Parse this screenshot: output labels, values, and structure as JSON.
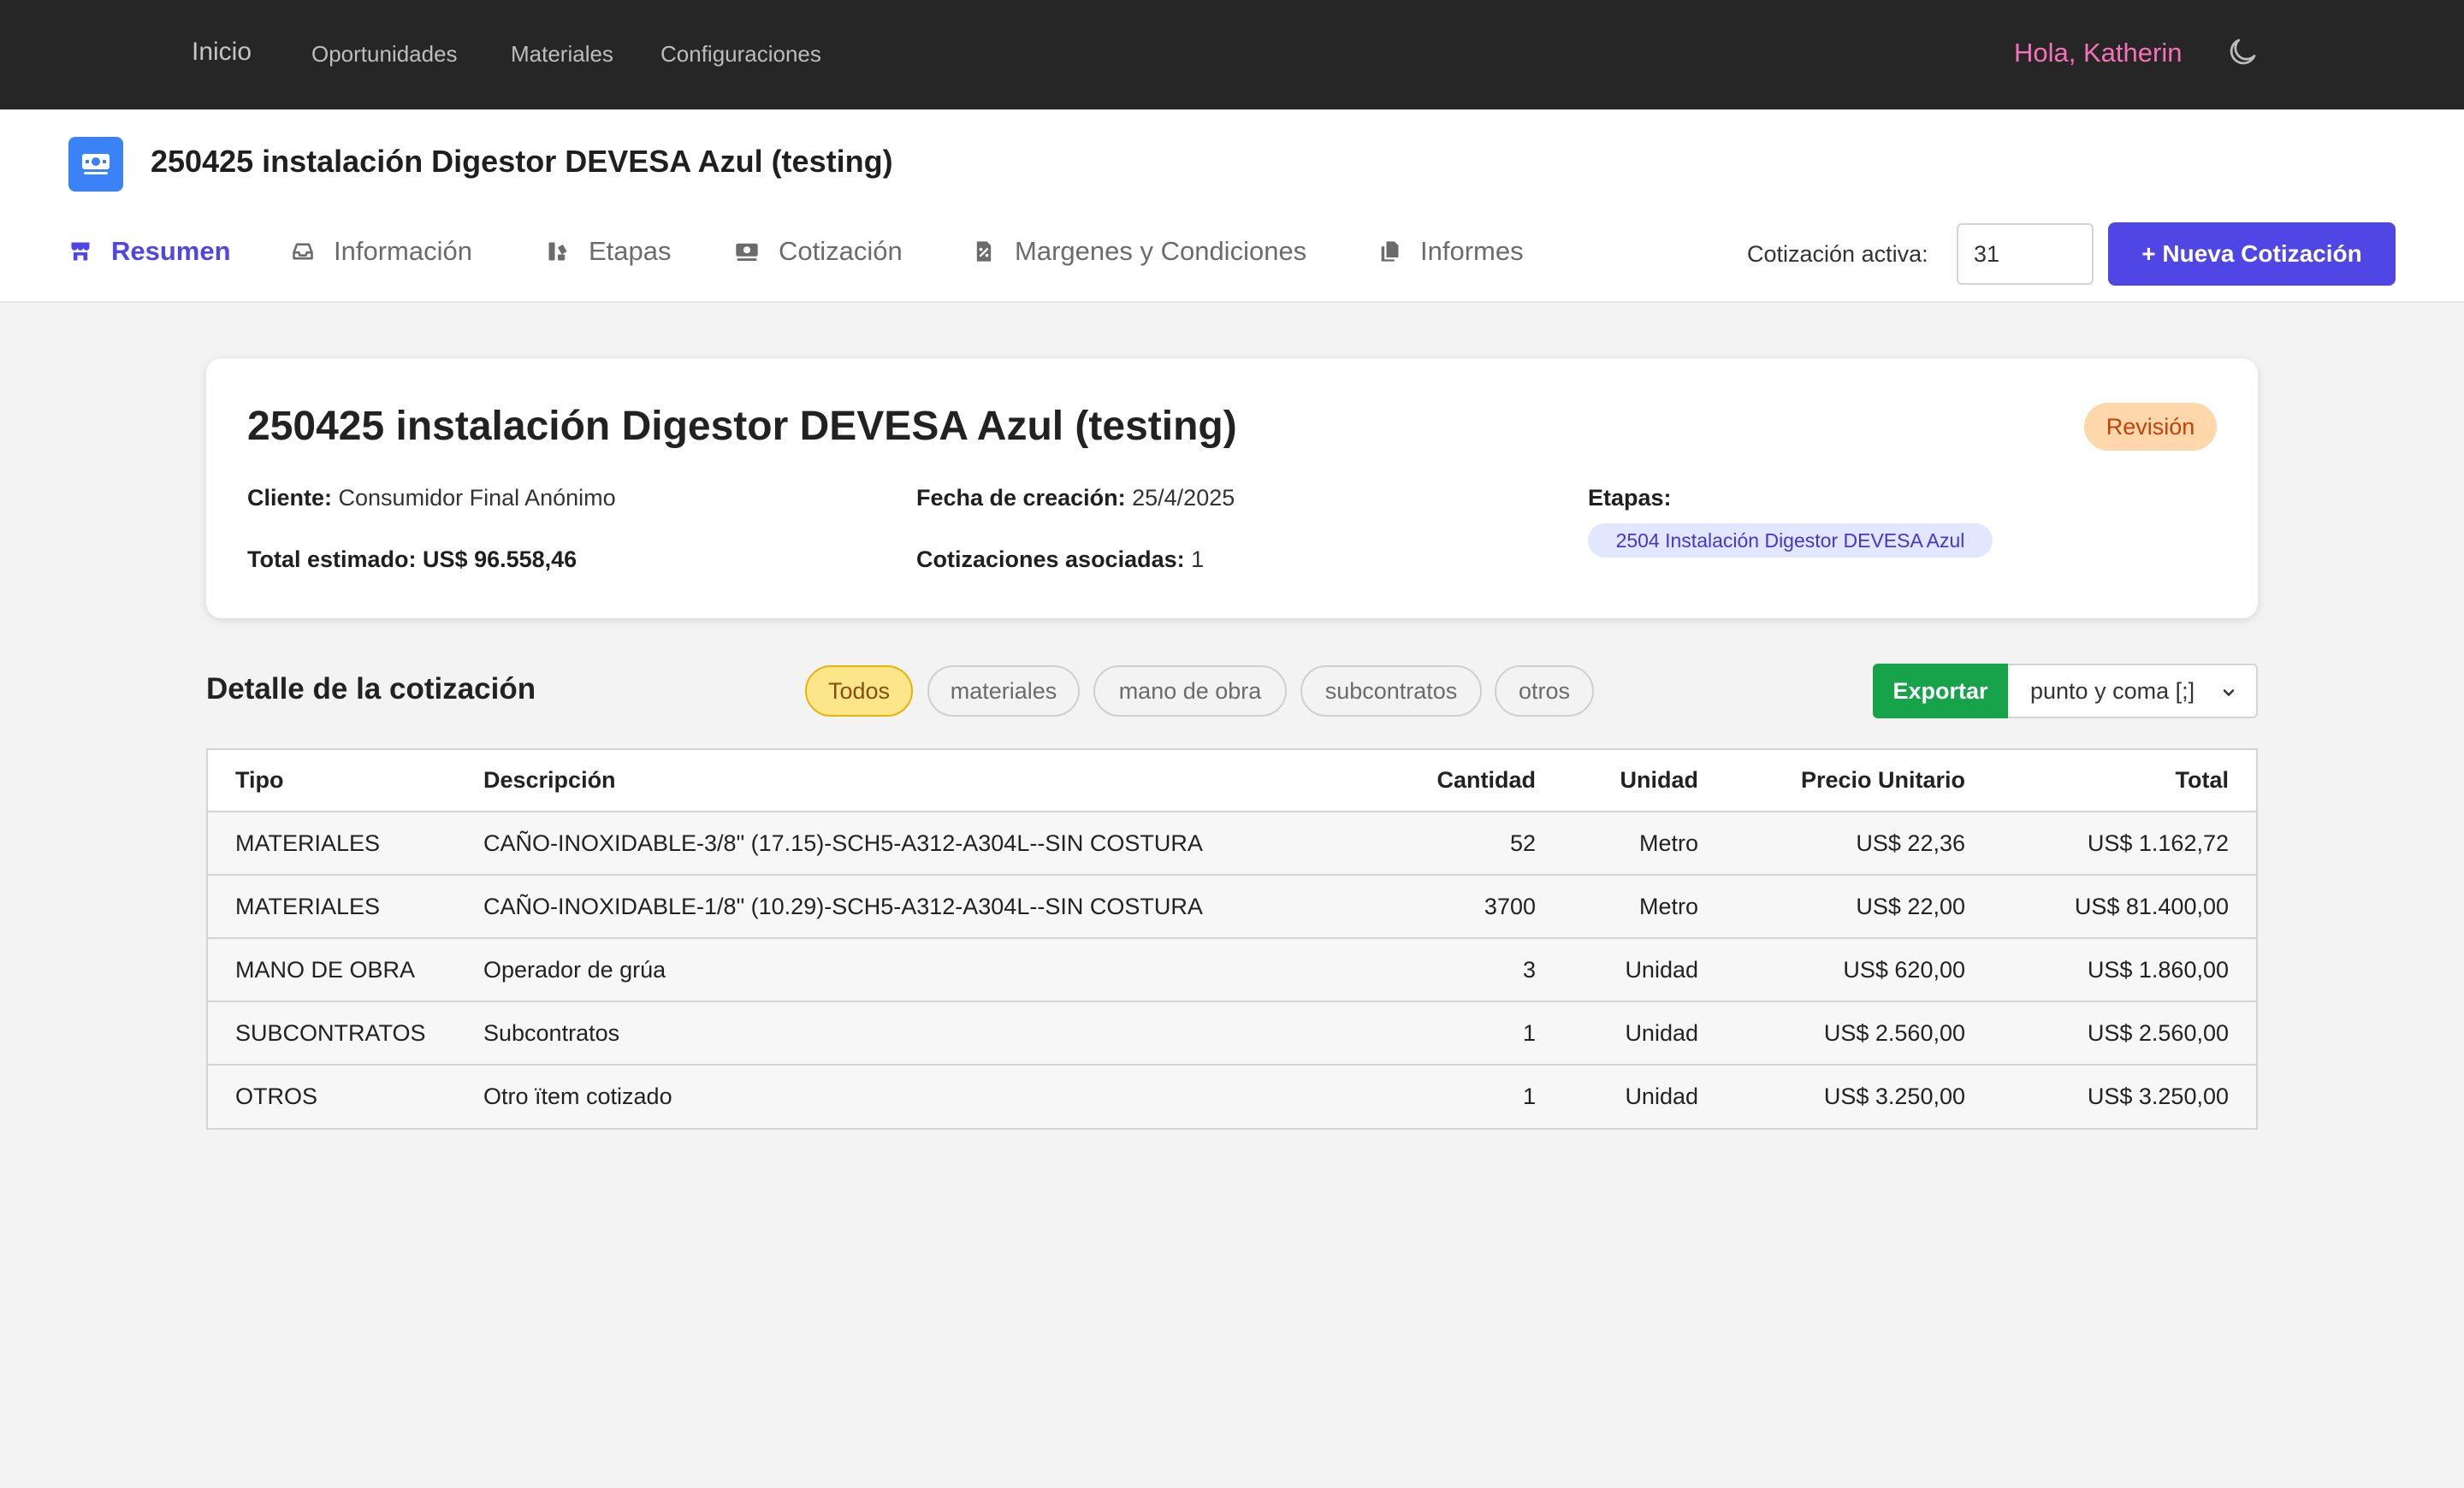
{
  "nav": {
    "home": "Inicio",
    "links": [
      "Oportunidades",
      "Materiales",
      "Configuraciones"
    ],
    "greeting": "Hola, Katherin",
    "theme_icon": "moon-icon"
  },
  "header": {
    "icon": "money-icon",
    "title": "250425 instalación Digestor DEVESA Azul (testing)",
    "tabs": [
      {
        "label": "Resumen",
        "icon": "store-icon",
        "active": true
      },
      {
        "label": "Información",
        "icon": "inbox-icon"
      },
      {
        "label": "Etapas",
        "icon": "stages-icon"
      },
      {
        "label": "Cotización",
        "icon": "money-icon"
      },
      {
        "label": "Margenes y Condiciones",
        "icon": "file-icon"
      },
      {
        "label": "Informes",
        "icon": "copy-icon"
      }
    ],
    "active_quote_label": "Cotización activa:",
    "active_quote_value": "31",
    "new_quote_label": "+ Nueva Cotización"
  },
  "summary": {
    "title": "250425 instalación Digestor DEVESA Azul (testing)",
    "status": "Revisión",
    "client_label": "Cliente:",
    "client_value": "Consumidor Final Anónimo",
    "created_label": "Fecha de creación:",
    "created_value": "25/4/2025",
    "stages_label": "Etapas:",
    "stage_pill": "2504 Instalación Digestor DEVESA Azul",
    "total_label": "Total estimado:",
    "total_value": "US$ 96.558,46",
    "quotes_label": "Cotizaciones asociadas:",
    "quotes_value": "1"
  },
  "detail": {
    "title": "Detalle de la cotización",
    "filters": [
      "Todos",
      "materiales",
      "mano de obra",
      "subcontratos",
      "otros"
    ],
    "active_filter": "Todos",
    "export_label": "Exportar",
    "separator_value": "punto y coma [;]"
  },
  "table": {
    "headers": [
      "Tipo",
      "Descripción",
      "Cantidad",
      "Unidad",
      "Precio Unitario",
      "Total"
    ],
    "rows": [
      [
        "MATERIALES",
        "CAÑO-INOXIDABLE-3/8\" (17.15)-SCH5-A312-A304L--SIN COSTURA",
        "52",
        "Metro",
        "US$ 22,36",
        "US$ 1.162,72"
      ],
      [
        "MATERIALES",
        "CAÑO-INOXIDABLE-1/8\" (10.29)-SCH5-A312-A304L--SIN COSTURA",
        "3700",
        "Metro",
        "US$ 22,00",
        "US$ 81.400,00"
      ],
      [
        "MANO DE OBRA",
        "Operador de grúa",
        "3",
        "Unidad",
        "US$ 620,00",
        "US$ 1.860,00"
      ],
      [
        "SUBCONTRATOS",
        "Subcontratos",
        "1",
        "Unidad",
        "US$ 2.560,00",
        "US$ 2.560,00"
      ],
      [
        "OTROS",
        "Otro ïtem cotizado",
        "1",
        "Unidad",
        "US$ 3.250,00",
        "US$ 3.250,00"
      ]
    ]
  },
  "colors": {
    "navbar": "#262626",
    "accent": "#4f46e5",
    "greeting": "#f472b6",
    "export": "#16a34a",
    "status_bg": "#fed7aa"
  }
}
